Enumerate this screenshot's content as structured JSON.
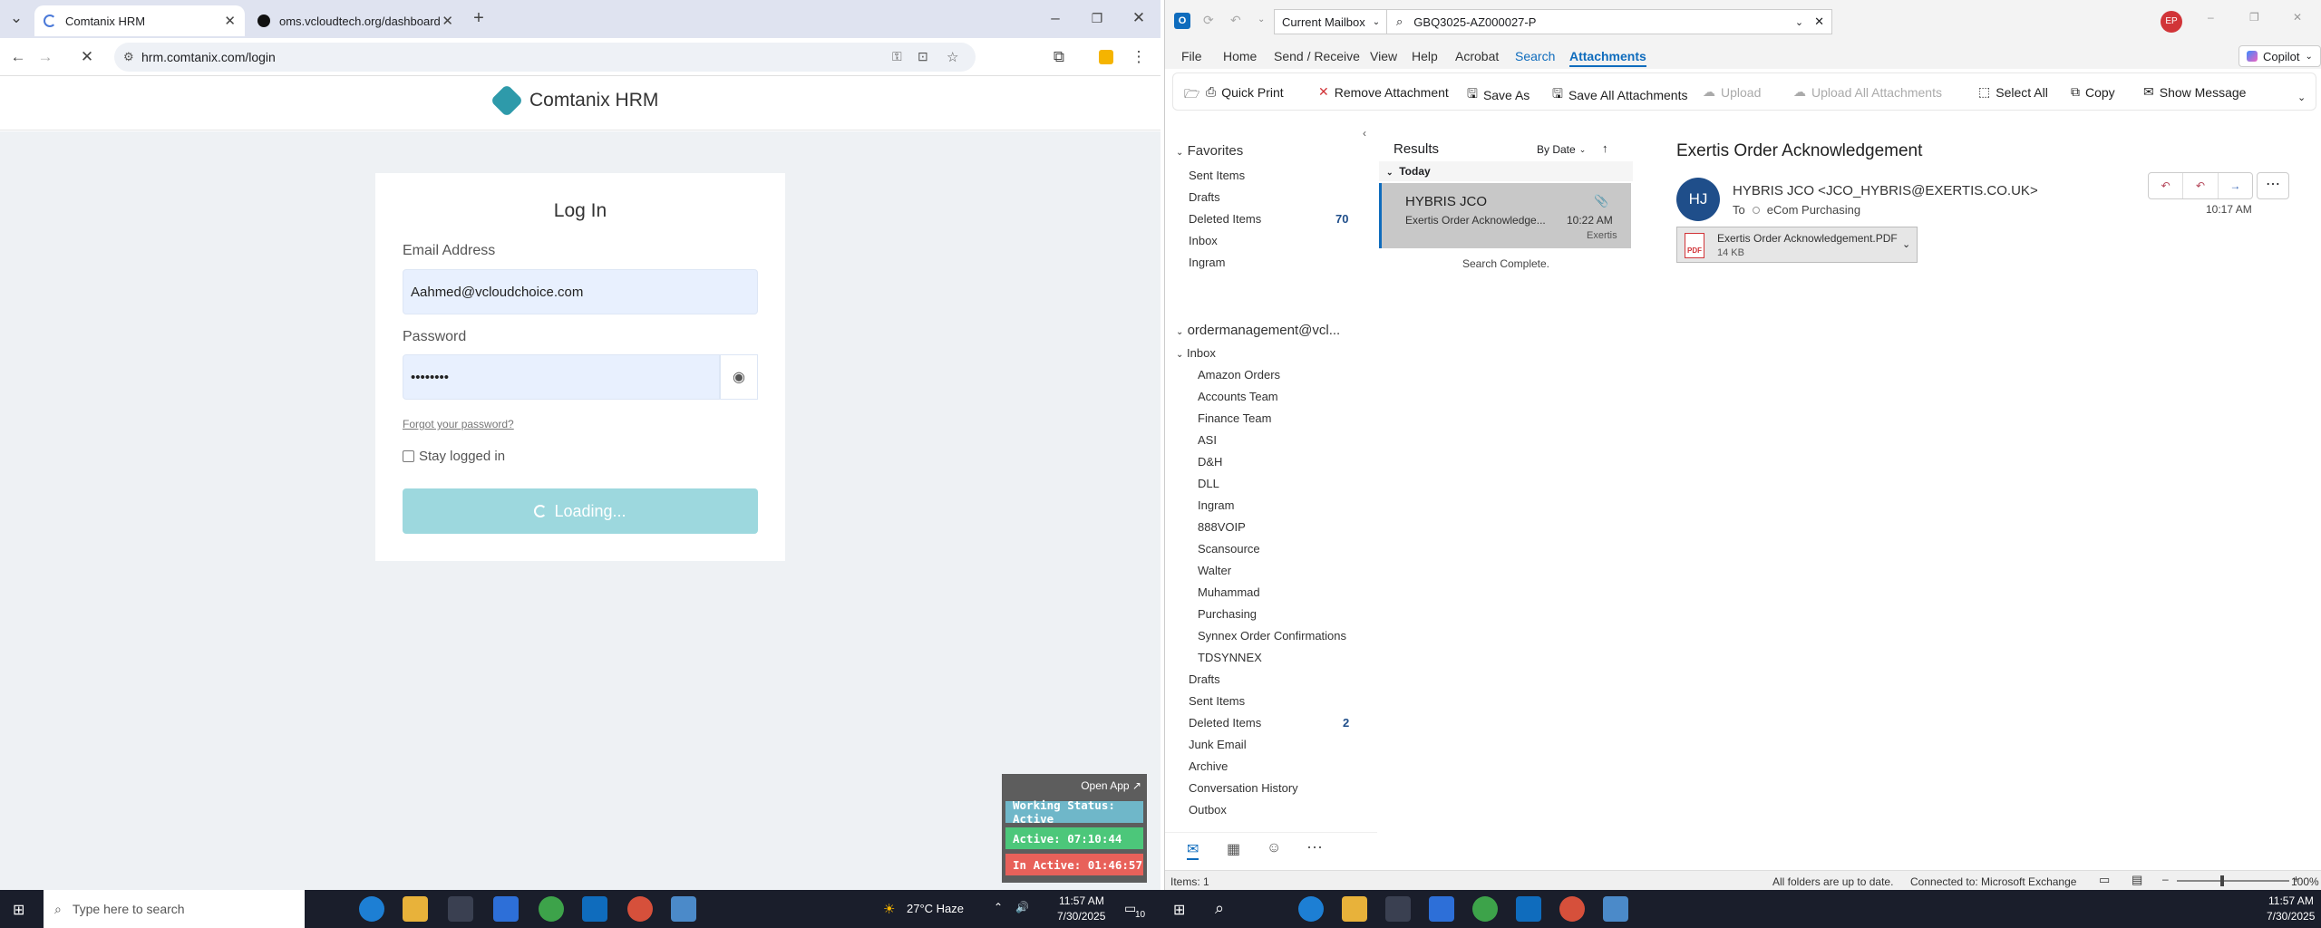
{
  "chrome": {
    "tabs": [
      {
        "label": "Comtanix HRM"
      },
      {
        "label": "oms.vcloudtech.org/dashboard"
      }
    ],
    "url": "hrm.comtanix.com/login"
  },
  "hrm": {
    "brand": "Comtanix HRM",
    "login_title": "Log In",
    "email_label": "Email Address",
    "email_value": "Aahmed@vcloudchoice.com",
    "password_label": "Password",
    "password_value": "••••••••",
    "forgot": "Forgot your password?",
    "stay_logged": "Stay logged in",
    "loading": "Loading..."
  },
  "widget": {
    "open_app": "Open App ↗",
    "working_status": "Working Status: Active",
    "active": "Active: 07:10:44",
    "inactive": "In Active: 01:46:57",
    "colors": {
      "status": "#6fb7c9",
      "active": "#4cc77a",
      "inactive": "#e8615a"
    }
  },
  "outlook": {
    "scope": "Current Mailbox",
    "search_query": "GBQ3025-AZ000027-P",
    "avatar": "EP",
    "copilot": "Copilot",
    "menu": [
      "File",
      "Home",
      "Send / Receive",
      "View",
      "Help",
      "Acrobat",
      "Search",
      "Attachments"
    ],
    "ribbon": {
      "quick_print": "Quick Print",
      "remove_attachment": "Remove Attachment",
      "save_as": "Save As",
      "save_all": "Save All Attachments",
      "upload": "Upload",
      "upload_all": "Upload All Attachments",
      "select_all": "Select All",
      "copy": "Copy",
      "show_message": "Show Message"
    },
    "favorites": {
      "header": "Favorites",
      "items": [
        {
          "label": "Sent Items",
          "count": ""
        },
        {
          "label": "Drafts",
          "count": ""
        },
        {
          "label": "Deleted Items",
          "count": "70"
        },
        {
          "label": "Inbox",
          "count": ""
        },
        {
          "label": "Ingram",
          "count": ""
        }
      ]
    },
    "account": {
      "header": "ordermanagement@vcl...",
      "inbox": "Inbox",
      "subfolders": [
        "Amazon Orders",
        "Accounts Team",
        "Finance Team",
        "ASI",
        "D&H",
        "DLL",
        "Ingram",
        "888VOIP",
        "Scansource",
        "Walter",
        "Muhammad",
        "Purchasing",
        "Synnex Order Confirmations",
        "TDSYNNEX"
      ],
      "folders": [
        {
          "label": "Drafts",
          "count": ""
        },
        {
          "label": "Sent Items",
          "count": ""
        },
        {
          "label": "Deleted Items",
          "count": "2"
        },
        {
          "label": "Junk Email",
          "count": ""
        },
        {
          "label": "Archive",
          "count": ""
        },
        {
          "label": "Conversation History",
          "count": ""
        },
        {
          "label": "Outbox",
          "count": ""
        }
      ]
    },
    "results": {
      "title": "Results",
      "sort": "By Date",
      "group": "Today",
      "message": {
        "sender": "HYBRIS JCO",
        "subject": "Exertis Order Acknowledge...",
        "time": "10:22 AM",
        "folder": "Exertis"
      },
      "status": "Search Complete."
    },
    "reading": {
      "subject": "Exertis Order Acknowledgement",
      "initials": "HJ",
      "from": "HYBRIS JCO <JCO_HYBRIS@EXERTIS.CO.UK>",
      "to_label": "To",
      "to": "eCom Purchasing",
      "time": "10:17 AM",
      "attachment_name": "Exertis Order Acknowledgement.PDF",
      "attachment_size": "14 KB"
    },
    "status": {
      "items": "Items: 1",
      "sync": "All folders are up to date.",
      "connection": "Connected to: Microsoft Exchange",
      "zoom": "100%"
    }
  },
  "taskbar": {
    "search_placeholder": "Type here to search",
    "weather": "27°C  Haze",
    "time": "11:57 AM",
    "date": "7/30/2025",
    "badge": "10",
    "time2": "11:57 AM",
    "date2": "7/30/2025"
  }
}
